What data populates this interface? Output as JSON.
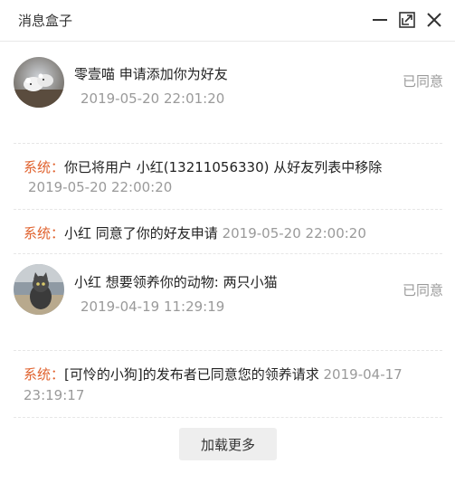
{
  "window": {
    "title": "消息盒子"
  },
  "titlebar_icons": [
    "minimize-icon",
    "maximize-icon",
    "close-icon"
  ],
  "colors": {
    "system_label": "#e0622e",
    "time_text": "#9a9a9a",
    "status_text": "#9a9a9a",
    "load_more_bg": "#eeeeee"
  },
  "messages": [
    {
      "type": "friend_request",
      "avatar": "avatar-mice",
      "sender": "零壹喵",
      "text": "申请添加你为好友",
      "time": "2019-05-20 22:01:20",
      "status": "已同意"
    },
    {
      "type": "system",
      "label": "系统：",
      "text": "你已将用户 小红(13211056330) 从好友列表中移除",
      "time": "2019-05-20 22:00:20"
    },
    {
      "type": "system",
      "label": "系统：",
      "text": "小红 同意了你的好友申请",
      "time": "2019-05-20 22:00:20"
    },
    {
      "type": "adoption_request",
      "avatar": "avatar-cat",
      "sender": "小红",
      "text": "想要领养你的动物: 两只小猫",
      "time": "2019-04-19 11:29:19",
      "status": "已同意"
    },
    {
      "type": "system",
      "label": "系统：",
      "text": "[可怜的小狗]的发布者已同意您的领养请求",
      "time_part1": "2019-04-17",
      "time_part2": "23:19:17"
    }
  ],
  "load_more_label": "加载更多"
}
